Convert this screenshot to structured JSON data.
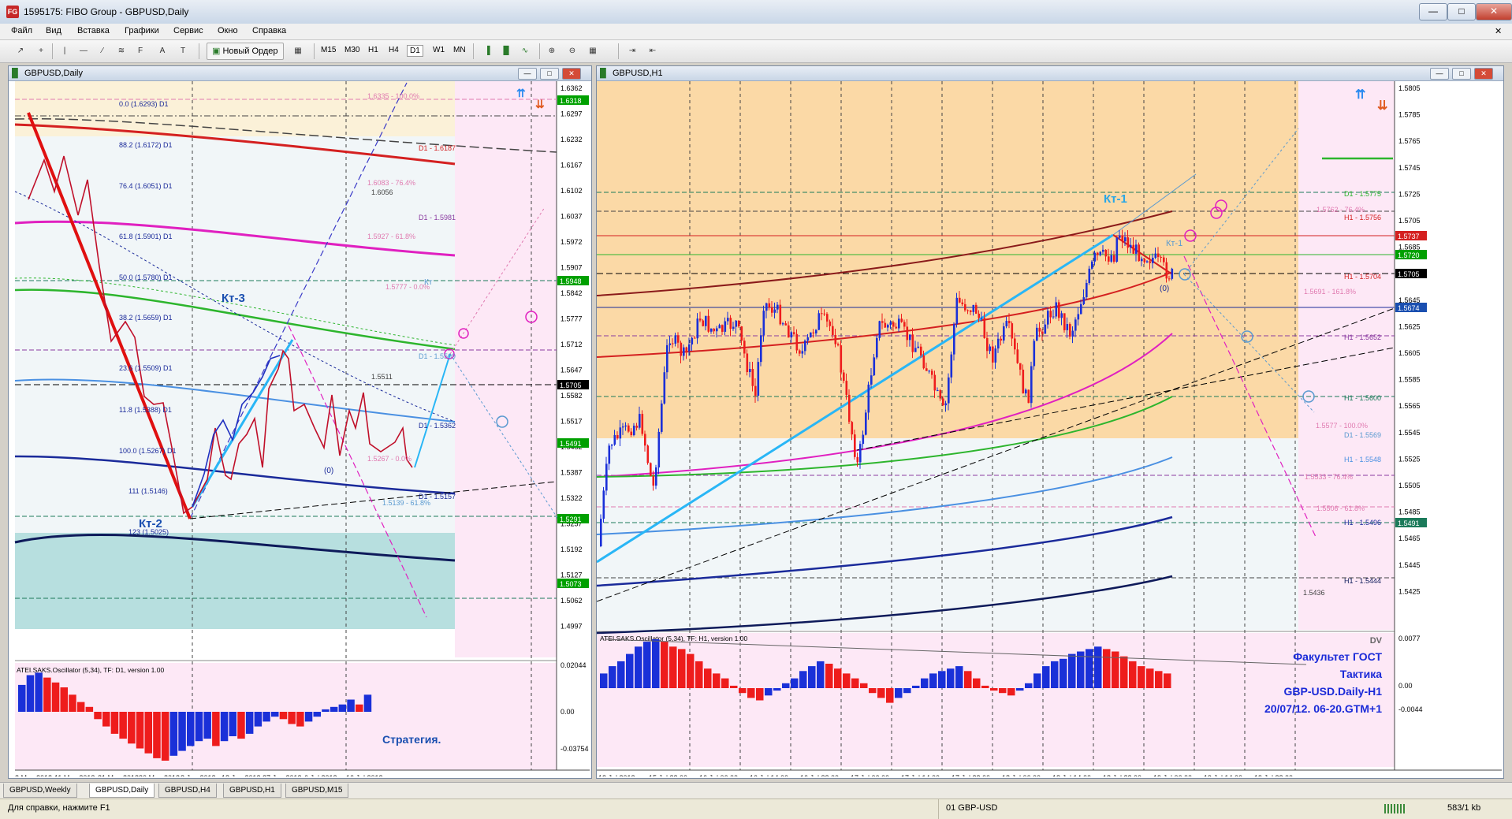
{
  "window": {
    "title": "1595175: FIBO Group - GBPUSD,Daily",
    "icon_text": "FG"
  },
  "menu": [
    "Файл",
    "Вид",
    "Вставка",
    "Графики",
    "Сервис",
    "Окно",
    "Справка"
  ],
  "toolbar": {
    "new_order": "Новый Ордер",
    "timeframes": [
      "M15",
      "M30",
      "H1",
      "H4",
      "D1",
      "W1",
      "MN"
    ],
    "active_timeframe": "D1"
  },
  "left_chart": {
    "title": "GBPUSD,Daily",
    "price_ticks": [
      "1.6362",
      "1.6297",
      "1.6232",
      "1.6167",
      "1.6102",
      "1.6037",
      "1.5972",
      "1.5907",
      "1.5842",
      "1.5777",
      "1.5712",
      "1.5647",
      "1.5582",
      "1.5517",
      "1.5452",
      "1.5387",
      "1.5322",
      "1.5257",
      "1.5192",
      "1.5127",
      "1.5062",
      "1.4997"
    ],
    "price_tags": [
      {
        "text": "1.6318",
        "color": "#00a000"
      },
      {
        "text": "1.5948",
        "color": "#00a000"
      },
      {
        "text": "1.5705",
        "color": "#000000"
      },
      {
        "text": "1.5491",
        "color": "#00a000"
      },
      {
        "text": "1.5291",
        "color": "#00a000"
      },
      {
        "text": "1.5073",
        "color": "#00a000"
      }
    ],
    "fibo_labels": [
      "0.0 (1.6293) D1",
      "88.2 (1.6172) D1",
      "76.4 (1.6051) D1",
      "61.8 (1.5901) D1",
      "50.0 (1.5780) D1",
      "38.2 (1.5659) D1",
      "23.6 (1.5509) D1",
      "11.8 (1.5388) D1",
      "100.0 (1.5267) D1",
      "111 (1.5146)",
      "123 (1.5025)"
    ],
    "right_labels": [
      "1.6335 - 100.0%",
      "D1 - 1.6187",
      "1.6083 - 76.4%",
      "1.6056",
      "D1 - 1.5981",
      "1.5927 - 61.8%",
      "1.5777 - 0.0%",
      "D1 - 1.5569",
      "1.5511",
      "D1 - 1.5362",
      "1.5267 - 0.0%",
      "D1 - 1.5157",
      "1.5139 - 61.8%"
    ],
    "wave_labels": [
      "Кт-3",
      "Кт-2",
      "Кт",
      "(0)"
    ],
    "date_ticks": [
      "2 May 2012",
      "11 May 2012",
      "21 May 2012",
      "30 May 2012",
      "8 Jun 2012",
      "18 Jun 2012",
      "27 Jun 2012",
      "6 Jul 2012",
      "16 Jul 2012"
    ],
    "oscillator": {
      "title": "ATEI.SAKS.Oscillator (5,34), TF: D1, version 1.00",
      "ticks": [
        "0.02044",
        "0.00",
        "-0.03754"
      ],
      "label": "Стратегия.",
      "values": [
        0.55,
        0.75,
        0.8,
        0.7,
        0.6,
        0.5,
        0.35,
        0.2,
        0.1,
        -0.15,
        -0.3,
        -0.45,
        -0.55,
        -0.65,
        -0.75,
        -0.85,
        -0.95,
        -1.0,
        -0.9,
        -0.8,
        -0.7,
        -0.6,
        -0.55,
        -0.7,
        -0.6,
        -0.5,
        -0.55,
        -0.45,
        -0.3,
        -0.2,
        -0.1,
        -0.15,
        -0.25,
        -0.3,
        -0.2,
        -0.1,
        0.05,
        0.1,
        0.15,
        0.25,
        0.15,
        0.35
      ]
    }
  },
  "right_chart": {
    "title": "GBPUSD,H1",
    "price_ticks": [
      "1.5805",
      "1.5785",
      "1.5765",
      "1.5745",
      "1.5725",
      "1.5705",
      "1.5685",
      "1.5665",
      "1.5645",
      "1.5625",
      "1.5605",
      "1.5585",
      "1.5565",
      "1.5545",
      "1.5525",
      "1.5505",
      "1.5485",
      "1.5465",
      "1.5445",
      "1.5425"
    ],
    "price_tags": [
      {
        "text": "1.5737",
        "color": "#d42020"
      },
      {
        "text": "1.5720",
        "color": "#00a000"
      },
      {
        "text": "1.5705",
        "color": "#000000"
      },
      {
        "text": "1.5674",
        "color": "#1a4fb0"
      },
      {
        "text": "1.5491",
        "color": "#1b7a5a"
      }
    ],
    "right_labels": [
      "D1 - 1.5775",
      "H1 - 1.5756",
      "H1 - 1.5704",
      "H1 - 1.5652",
      "H1 - 1.5600",
      "D1 - 1.5569",
      "H1 - 1.5548",
      "H1 - 1.5496",
      "H1 - 1.5444"
    ],
    "mid_labels": [
      "1.5762 - 76.4%",
      "1.5691 - 161.8%",
      "1.5577 - 100.0%",
      "1.5533 - 76.4%",
      "1.5506 - 61.8%",
      "1.5436"
    ],
    "wave_labels": [
      "Кт-1",
      "Кт-1",
      "(0)"
    ],
    "date_ticks": [
      "13 Jul 2012",
      "15 Jul 22:00",
      "16 Jul 06:00",
      "16 Jul 14:00",
      "16 Jul 22:00",
      "17 Jul 06:00",
      "17 Jul 14:00",
      "17 Jul 22:00",
      "18 Jul 06:00",
      "18 Jul 14:00",
      "18 Jul 22:00",
      "19 Jul 06:00",
      "19 Jul 14:00",
      "19 Jul 22:00"
    ],
    "oscillator": {
      "title": "ATEI.SAKS.Oscillator (5,34), TF: H1, version 1.00",
      "ticks": [
        "0.0077",
        "0.00",
        "-0.0044"
      ],
      "values": [
        0.3,
        0.45,
        0.55,
        0.7,
        0.85,
        0.95,
        1.0,
        0.95,
        0.85,
        0.8,
        0.7,
        0.55,
        0.4,
        0.3,
        0.2,
        0.05,
        -0.1,
        -0.2,
        -0.25,
        -0.15,
        -0.05,
        0.1,
        0.2,
        0.35,
        0.45,
        0.55,
        0.5,
        0.4,
        0.3,
        0.2,
        0.1,
        -0.1,
        -0.2,
        -0.3,
        -0.2,
        -0.1,
        0.05,
        0.2,
        0.3,
        0.35,
        0.4,
        0.45,
        0.35,
        0.2,
        0.05,
        -0.05,
        -0.1,
        -0.15,
        -0.05,
        0.1,
        0.3,
        0.45,
        0.55,
        0.6,
        0.7,
        0.75,
        0.8,
        0.85,
        0.8,
        0.75,
        0.65,
        0.55,
        0.45,
        0.4,
        0.35,
        0.3
      ]
    },
    "annotation": [
      "DV",
      "Факультет ГОСТ",
      "Тактика",
      "GBP-USD.Daily-H1",
      "20/07/12. 06-20.GTM+1"
    ]
  },
  "bottom_tabs": [
    {
      "label": "GBPUSD,Weekly",
      "active": false
    },
    {
      "label": "GBPUSD,Daily",
      "active": true
    },
    {
      "label": "GBPUSD,H4",
      "active": false
    },
    {
      "label": "GBPUSD,H1",
      "active": false
    },
    {
      "label": "GBPUSD,M15",
      "active": false
    }
  ],
  "status": {
    "help": "Для справки, нажмите F1",
    "profile": "01 GBP-USD",
    "traffic": "583/1 kb"
  }
}
